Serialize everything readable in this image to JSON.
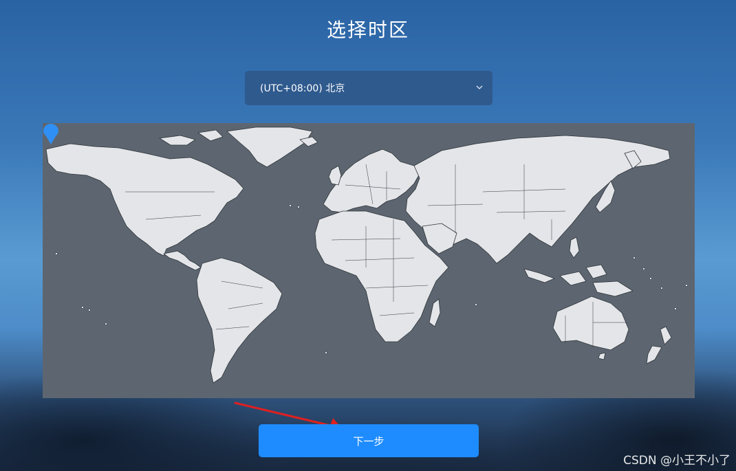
{
  "page": {
    "title": "选择时区"
  },
  "timezone_select": {
    "value": "(UTC+08:00) 北京",
    "icon": "chevron-down-icon"
  },
  "map": {
    "marker_icon": "location-pin-icon",
    "colors": {
      "ocean": "#5d6670",
      "land": "#e3e5e8",
      "border": "#2c3238",
      "marker": "#2f8ff5"
    }
  },
  "actions": {
    "next_label": "下一步"
  },
  "annotation": {
    "arrow_color": "#e02020"
  },
  "watermark": {
    "text": "CSDN @小王不小了"
  }
}
